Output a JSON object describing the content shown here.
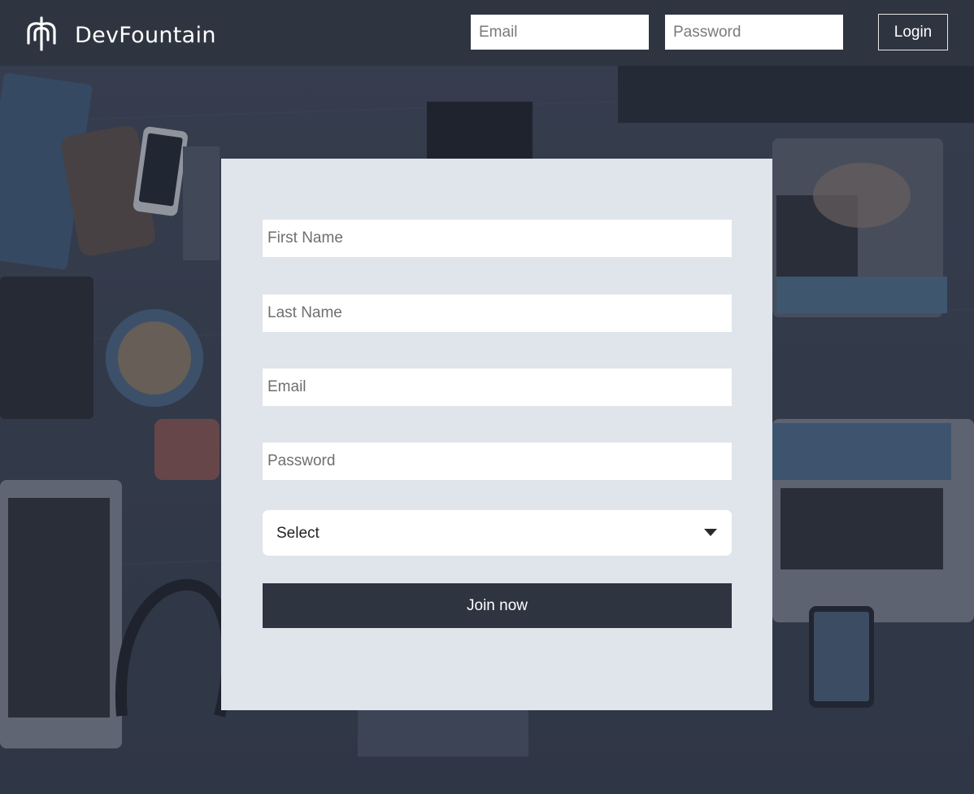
{
  "header": {
    "brand_name": "DevFountain",
    "logo_icon": "fountain-logo-icon",
    "email_placeholder": "Email",
    "password_placeholder": "Password",
    "login_label": "Login"
  },
  "signup": {
    "first_name_placeholder": "First Name",
    "last_name_placeholder": "Last Name",
    "email_placeholder": "Email",
    "password_placeholder": "Password",
    "select_value": "Select",
    "join_label": "Join now"
  },
  "colors": {
    "header_bg": "#2e3440",
    "card_bg": "#e0e4eb",
    "button_bg": "#2e3440"
  }
}
